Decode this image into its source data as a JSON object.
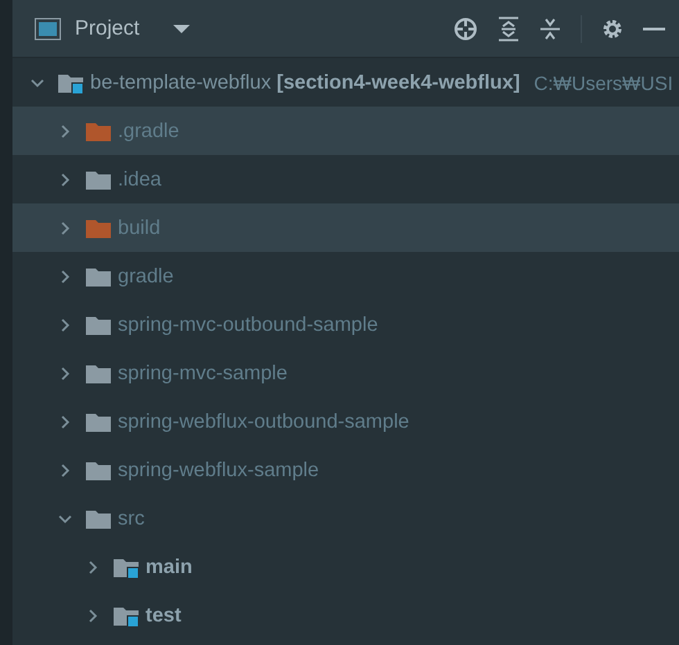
{
  "panel": {
    "title": "Project"
  },
  "tree": [
    {
      "name": "be-template-webflux",
      "branch": "[section4-week4-webflux]",
      "path": "C:₩Users₩USI",
      "kind": "module",
      "expanded": true,
      "highlighted": false,
      "children": [
        {
          "name": ".gradle",
          "kind": "excluded",
          "expanded": false,
          "highlighted": true
        },
        {
          "name": ".idea",
          "kind": "folder",
          "expanded": false,
          "highlighted": false
        },
        {
          "name": "build",
          "kind": "excluded",
          "expanded": false,
          "highlighted": true
        },
        {
          "name": "gradle",
          "kind": "folder",
          "expanded": false,
          "highlighted": false
        },
        {
          "name": "spring-mvc-outbound-sample",
          "kind": "folder",
          "expanded": false,
          "highlighted": false
        },
        {
          "name": "spring-mvc-sample",
          "kind": "folder",
          "expanded": false,
          "highlighted": false
        },
        {
          "name": "spring-webflux-outbound-sample",
          "kind": "folder",
          "expanded": false,
          "highlighted": false
        },
        {
          "name": "spring-webflux-sample",
          "kind": "folder",
          "expanded": false,
          "highlighted": false
        },
        {
          "name": "src",
          "kind": "folder",
          "expanded": true,
          "highlighted": false,
          "children": [
            {
              "name": "main",
              "kind": "module",
              "expanded": false,
              "highlighted": false
            },
            {
              "name": "test",
              "kind": "module",
              "expanded": false,
              "highlighted": false
            }
          ]
        }
      ]
    }
  ]
}
